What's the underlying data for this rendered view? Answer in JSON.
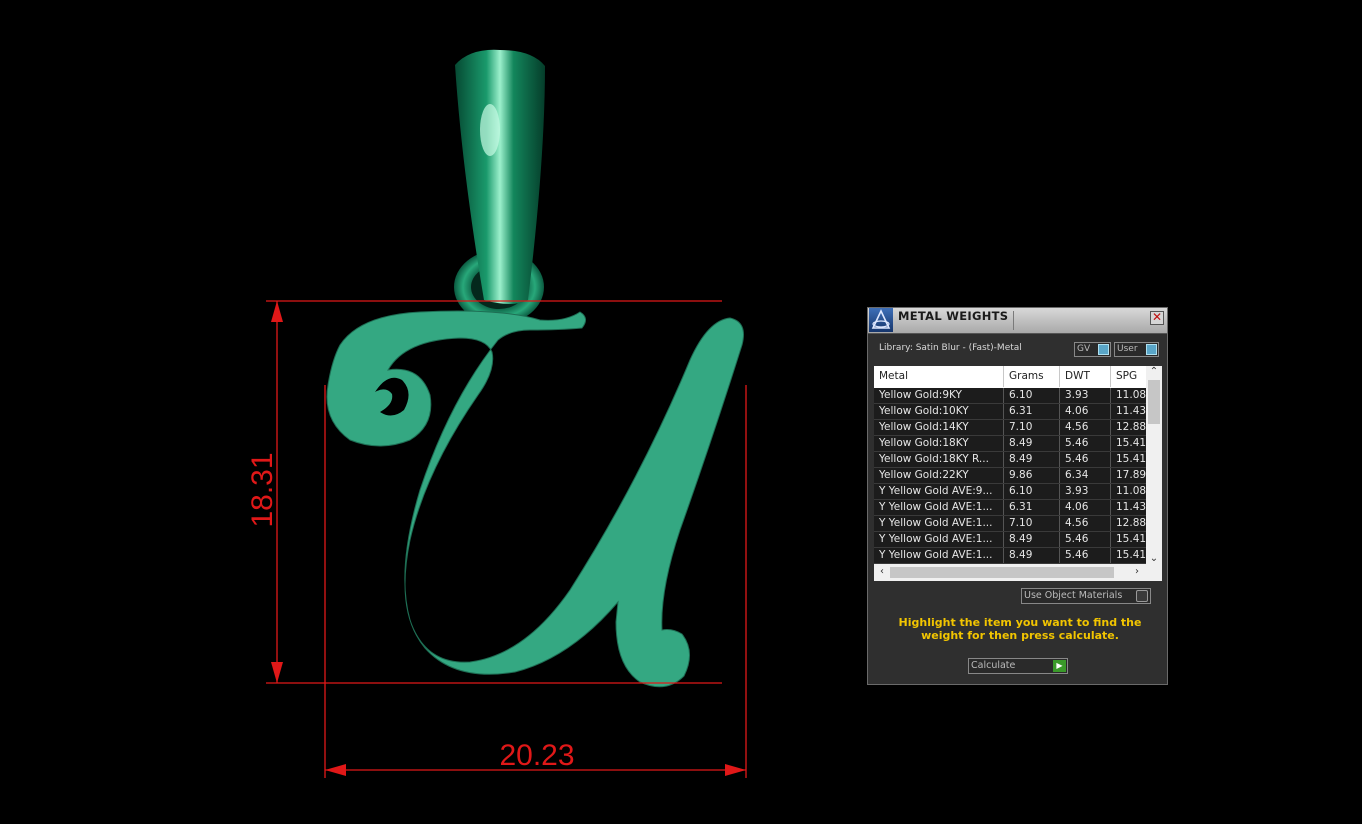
{
  "viewport": {
    "pendant_color": "#34a882",
    "bail_color": "#0f7a55",
    "dimension_color": "#e01818",
    "height_dimension": "18.31",
    "width_dimension": "20.23"
  },
  "panel": {
    "title": "METAL WEIGHTS",
    "close_label": "✕",
    "library_label": "Library: Satin Blur - (Fast)-Metal",
    "toggles": {
      "gv": "GV",
      "user": "User"
    },
    "columns": [
      "Metal",
      "Grams",
      "DWT",
      "SPG"
    ],
    "rows": [
      [
        "Yellow Gold:9KY",
        "6.10",
        "3.93",
        "11.08"
      ],
      [
        "Yellow Gold:10KY",
        "6.31",
        "4.06",
        "11.43"
      ],
      [
        "Yellow Gold:14KY",
        "7.10",
        "4.56",
        "12.88"
      ],
      [
        "Yellow Gold:18KY",
        "8.49",
        "5.46",
        "15.41"
      ],
      [
        "Yellow Gold:18KY R...",
        "8.49",
        "5.46",
        "15.41"
      ],
      [
        "Yellow Gold:22KY",
        "9.86",
        "6.34",
        "17.89"
      ],
      [
        "Y Yellow Gold AVE:9...",
        "6.10",
        "3.93",
        "11.08"
      ],
      [
        "Y Yellow Gold AVE:1...",
        "6.31",
        "4.06",
        "11.43"
      ],
      [
        "Y Yellow Gold AVE:1...",
        "7.10",
        "4.56",
        "12.88"
      ],
      [
        "Y Yellow Gold AVE:1...",
        "8.49",
        "5.46",
        "15.41"
      ],
      [
        "Y Yellow Gold AVE:1...",
        "8.49",
        "5.46",
        "15.41"
      ]
    ],
    "use_object_materials_label": "Use Object Materials",
    "hint_text": "Highlight the item you want to find the weight for then press calculate.",
    "calculate_label": "Calculate",
    "accent_color": "#f2c500"
  }
}
